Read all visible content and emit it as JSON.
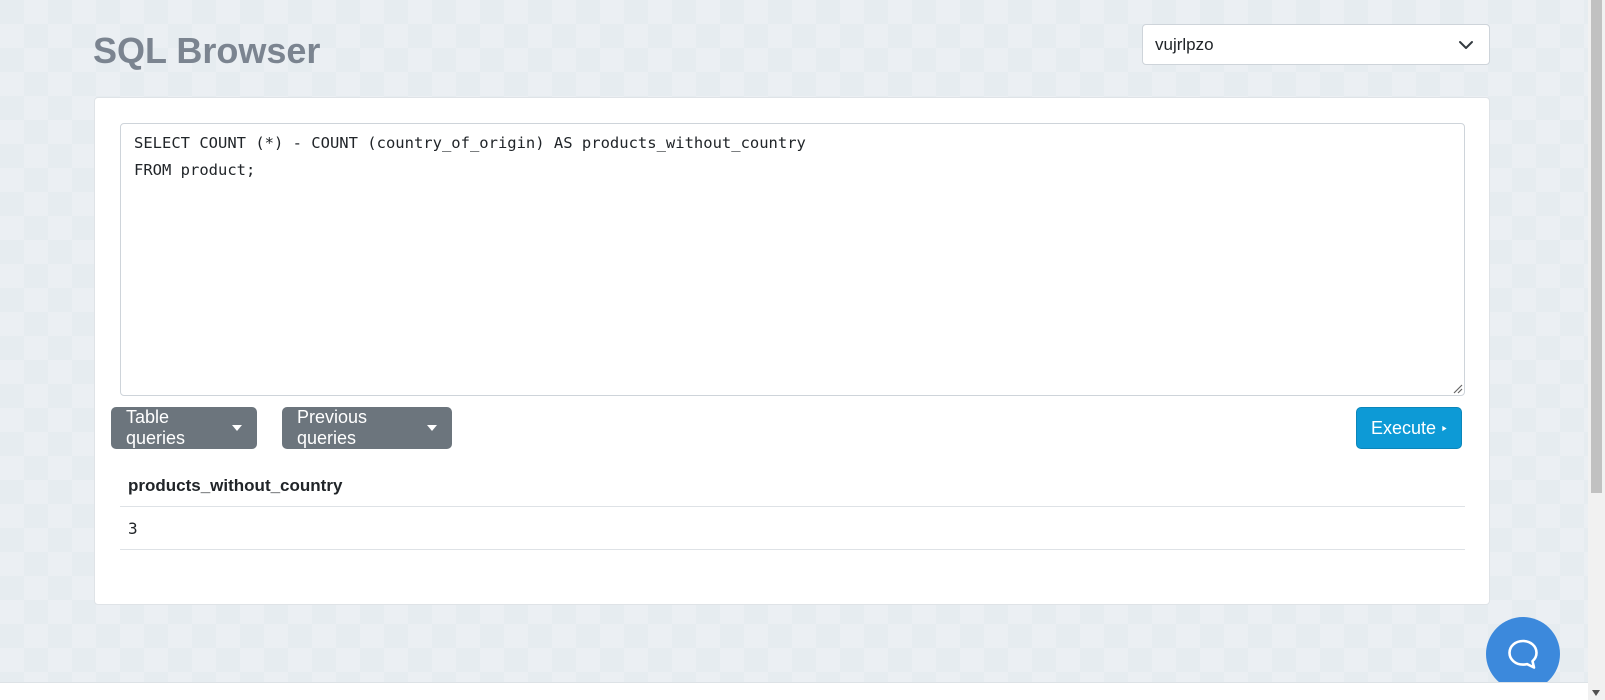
{
  "header": {
    "title": "SQL Browser",
    "database_selected": "vujrlpzo"
  },
  "editor": {
    "query": "SELECT COUNT (*) - COUNT (country_of_origin) AS products_without_country\nFROM product;"
  },
  "toolbar": {
    "table_queries_label": "Table queries",
    "previous_queries_label": "Previous queries",
    "execute_label": "Execute"
  },
  "results": {
    "columns": [
      "products_without_country"
    ],
    "rows": [
      [
        "3"
      ]
    ]
  },
  "colors": {
    "execute": "#0d9ad6",
    "secondary": "#6c757d",
    "chat": "#3c89dc"
  },
  "icons": {
    "db_select": "chevron-down-icon",
    "execute": "play-icon",
    "chat": "chat-bubble-icon"
  }
}
